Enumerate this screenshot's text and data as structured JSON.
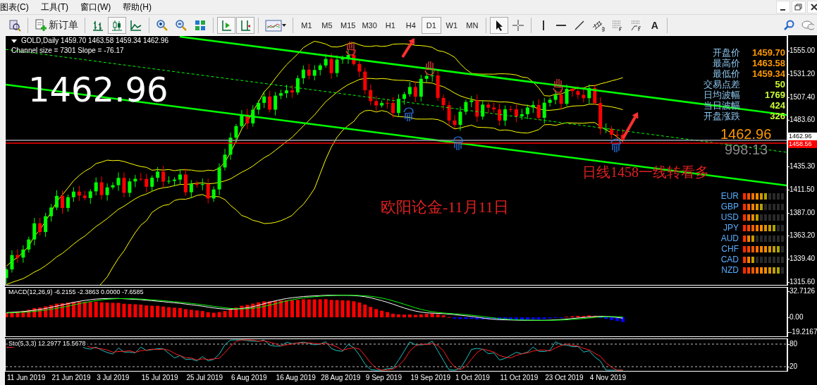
{
  "menu": [
    {
      "label": "图表(C)"
    },
    {
      "label": "工具(T)"
    },
    {
      "label": "窗口(W)"
    },
    {
      "label": "帮助(H)"
    }
  ],
  "toolbar": {
    "new_order": "新订单",
    "timeframes": [
      {
        "label": "M1",
        "selected": false
      },
      {
        "label": "M5",
        "selected": false
      },
      {
        "label": "M15",
        "selected": false
      },
      {
        "label": "M30",
        "selected": false
      },
      {
        "label": "H1",
        "selected": false
      },
      {
        "label": "H4",
        "selected": false
      },
      {
        "label": "D1",
        "selected": true
      },
      {
        "label": "W1",
        "selected": false
      },
      {
        "label": "MN",
        "selected": false
      }
    ],
    "text_tool": "A"
  },
  "chart": {
    "header": "GOLD,Daily  1459.70 1463.58 1459.34 1462.96",
    "channel_info": "Channel size = 7301 Slope = -76.17",
    "big_price": "1462.96",
    "stats": [
      {
        "label": "开盘价",
        "value": "1459.70",
        "color": "#ff9900"
      },
      {
        "label": "最高价",
        "value": "1463.58",
        "color": "#ff9900"
      },
      {
        "label": "最低价",
        "value": "1459.34",
        "color": "#ff9900"
      },
      {
        "label": "交易点差",
        "value": "50",
        "color": "#ccff33"
      },
      {
        "label": "日均波幅",
        "value": "1769",
        "color": "#ccff33"
      },
      {
        "label": "当日波幅",
        "value": "424",
        "color": "#ccff33"
      },
      {
        "label": "开盘涨跌",
        "value": "326",
        "color": "#ccff33"
      }
    ],
    "last_price": "1462.96",
    "countdown": "998:13",
    "signal_note": "日线1458一线转看多",
    "headline": "欧阳论金-11月11日",
    "currencies": [
      {
        "code": "EUR",
        "level": 0.6
      },
      {
        "code": "GBP",
        "level": 0.5
      },
      {
        "code": "USD",
        "level": 0.4
      },
      {
        "code": "JPY",
        "level": 0.8
      },
      {
        "code": "AUD",
        "level": 0.3
      },
      {
        "code": "CHF",
        "level": 0.9
      },
      {
        "code": "CAD",
        "level": 0.3
      },
      {
        "code": "NZD",
        "level": 0.9
      }
    ],
    "price_axis": [
      "1555.00",
      "1531.20",
      "1507.40",
      "1483.60",
      "1435.30",
      "1411.50",
      "1387.00",
      "1363.20",
      "1339.40",
      "1315.60"
    ],
    "price_tags": [
      {
        "label": "1462.96",
        "kind": "bid"
      },
      {
        "label": "1458.56",
        "kind": "line"
      }
    ]
  },
  "macd": {
    "label": "MACD(12,26,9) -6.2155 -2.3863 0.0000 -7.6585",
    "axis": [
      "32.7126",
      "0.00",
      "-19.2167"
    ]
  },
  "stochastic": {
    "label": "Sto(5,3,3) 12.2977 15.5678",
    "axis": [
      "80",
      "20"
    ]
  },
  "dates": [
    "11 Jun 2019",
    "21 Jun 2019",
    "3 Jul 2019",
    "15 Jul 2019",
    "25 Jul 2019",
    "6 Aug 2019",
    "16 Aug 2019",
    "28 Aug 2019",
    "9 Sep 2019",
    "19 Sep 2019",
    "1 Oct 2019",
    "11 Oct 2019",
    "23 Oct 2019",
    "4 Nov 2019"
  ]
}
